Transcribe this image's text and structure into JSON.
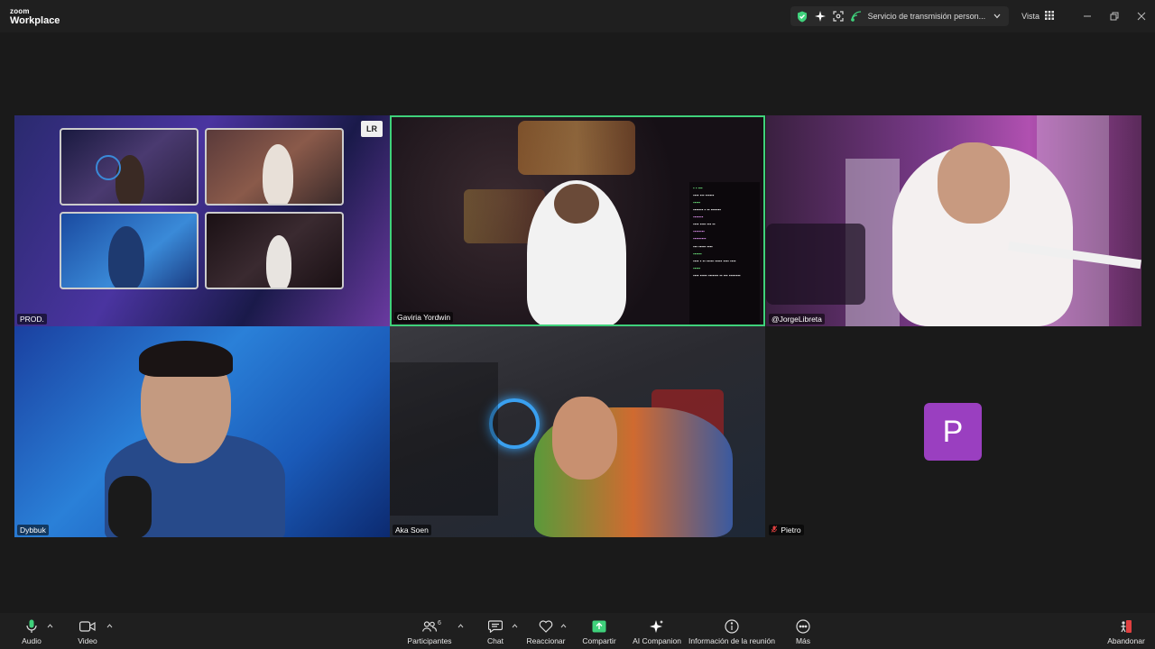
{
  "app": {
    "brand_top": "zoom",
    "brand_bottom": "Workplace"
  },
  "topbar": {
    "streaming_label": "Servicio de transmisión person...",
    "view_label": "Vista",
    "colors": {
      "shield": "#3fd17b",
      "stream": "#3fd17b"
    }
  },
  "participants": [
    {
      "name": "PROD."
    },
    {
      "name": "Gaviria Yordwin",
      "active_speaker": true
    },
    {
      "name": "@JorgeLibreta"
    },
    {
      "name": "Dybbuk"
    },
    {
      "name": "Aka Soen"
    },
    {
      "name": "Pietro",
      "avatar_letter": "P",
      "avatar_color": "#9a3fc0",
      "muted": true
    }
  ],
  "prod_tile": {
    "logo": "LR"
  },
  "toolbar": {
    "audio": "Audio",
    "video": "Video",
    "participants": "Participantes",
    "participants_count": "6",
    "chat": "Chat",
    "react": "Reaccionar",
    "share": "Compartir",
    "ai": "AI Companion",
    "info": "Información de la reunión",
    "more": "Más",
    "leave": "Abandonar"
  }
}
